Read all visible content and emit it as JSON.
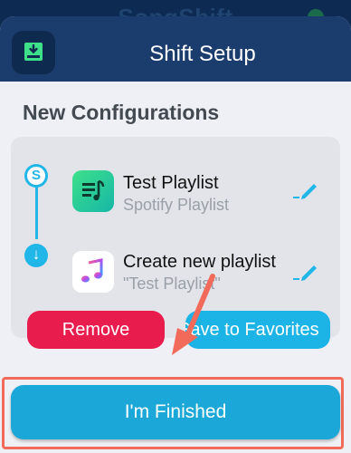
{
  "background_app": {
    "title": "SongShift"
  },
  "sheet": {
    "title": "Shift Setup",
    "header_icon": "download-tray-icon"
  },
  "section": {
    "title": "New Configurations"
  },
  "configuration": {
    "source": {
      "title": "Test Playlist",
      "subtitle": "Spotify Playlist",
      "icon": "spotify-playlist-icon"
    },
    "destination": {
      "title": "Create new playlist",
      "subtitle": "\"Test Playlist\"",
      "icon": "apple-music-icon"
    },
    "flow_start_glyph": "S",
    "flow_end_glyph": "↓"
  },
  "buttons": {
    "remove": "Remove",
    "favorites": "Save to Favorites",
    "finish": "I'm Finished"
  },
  "colors": {
    "header": "#1b3d6e",
    "accent": "#20b6e8",
    "remove": "#e81c4d",
    "finish": "#1ba8d8",
    "annotation": "#f26b5a"
  }
}
